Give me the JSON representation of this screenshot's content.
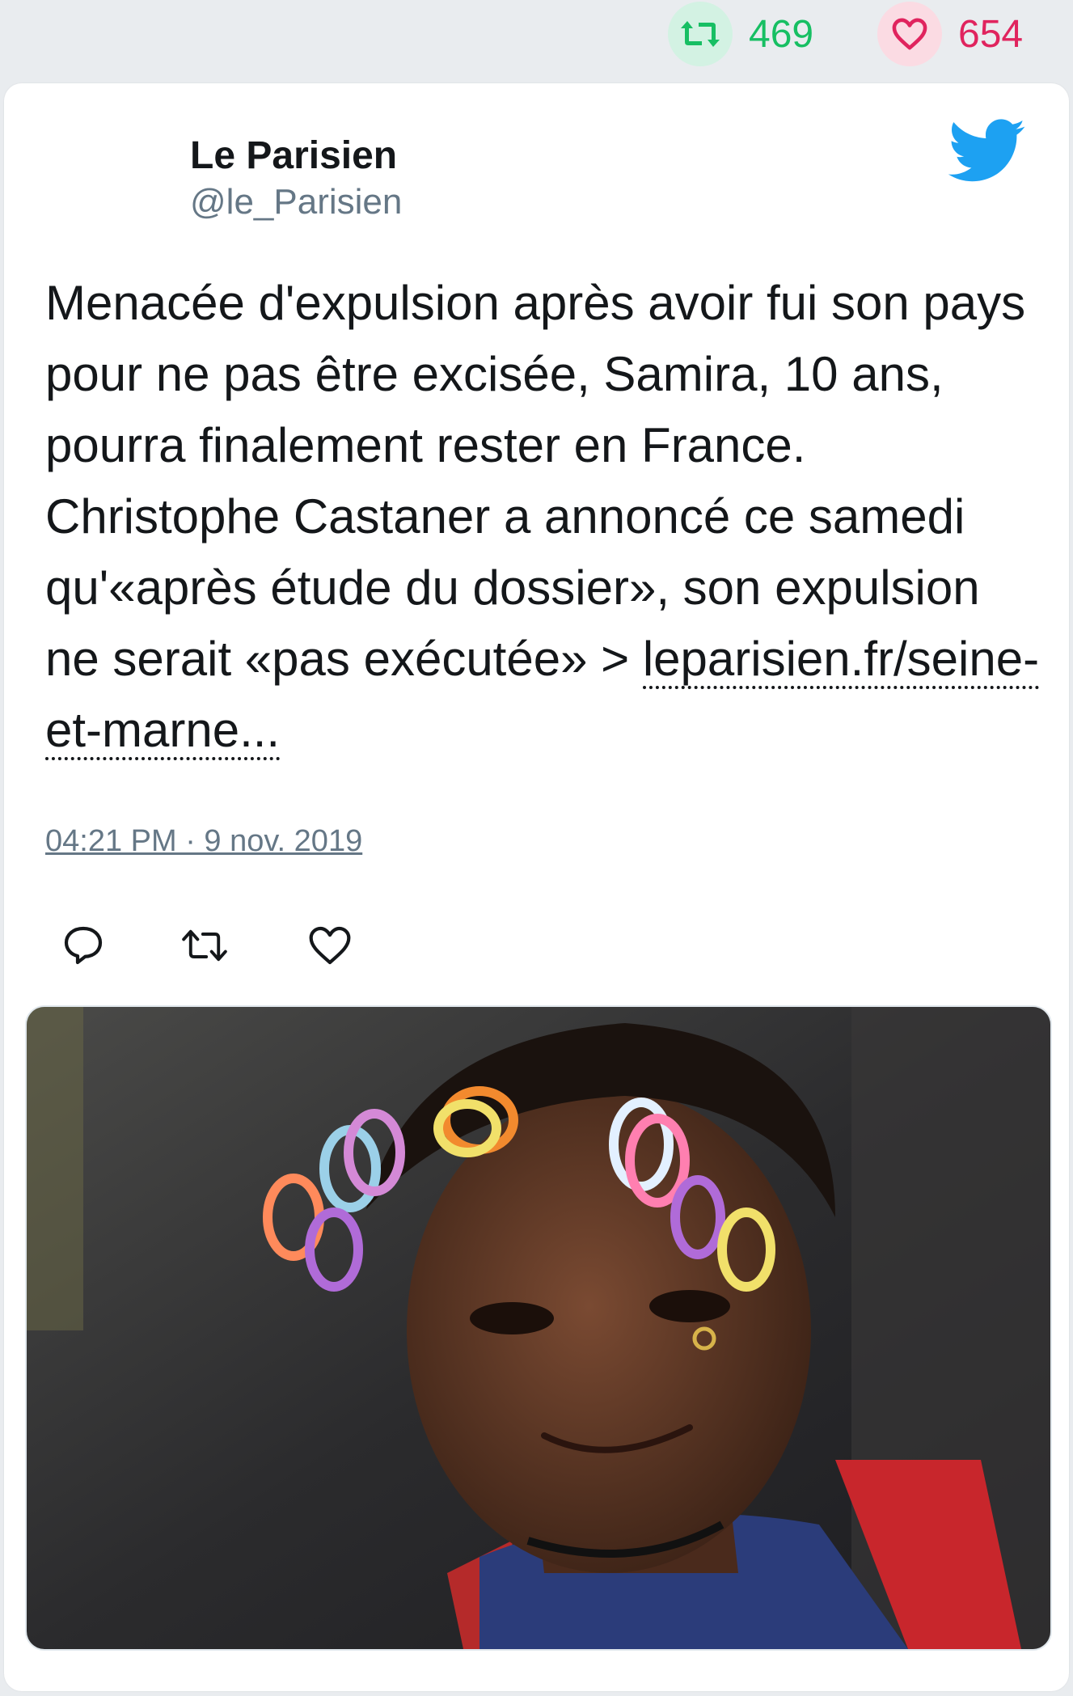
{
  "stats": {
    "retweets": "469",
    "likes": "654",
    "retweet_icon": "retweet-icon",
    "like_icon": "heart-icon",
    "colors": {
      "retweet": "#17bf63",
      "like": "#e0245e"
    }
  },
  "tweet": {
    "author_name": "Le Parisien",
    "author_handle": "@le_Parisien",
    "platform_icon": "twitter-bird-icon",
    "text": "Menacée d'expulsion après avoir fui son pays pour ne pas être excisée, Samira, 10 ans, pourra finalement rester en France. Christophe Castaner a annoncé ce samedi qu'«après étude du dossier», son expulsion ne serait «pas exécutée» > ",
    "link_text": "leparisien.fr/seine-et-marne...",
    "timestamp": "04:21 PM · 9 nov. 2019",
    "actions": [
      "reply-icon",
      "retweet-icon",
      "heart-icon"
    ]
  },
  "colors": {
    "twitter_blue": "#1da1f2",
    "text": "#14171a",
    "muted": "#657786",
    "background": "#e9ecef"
  }
}
